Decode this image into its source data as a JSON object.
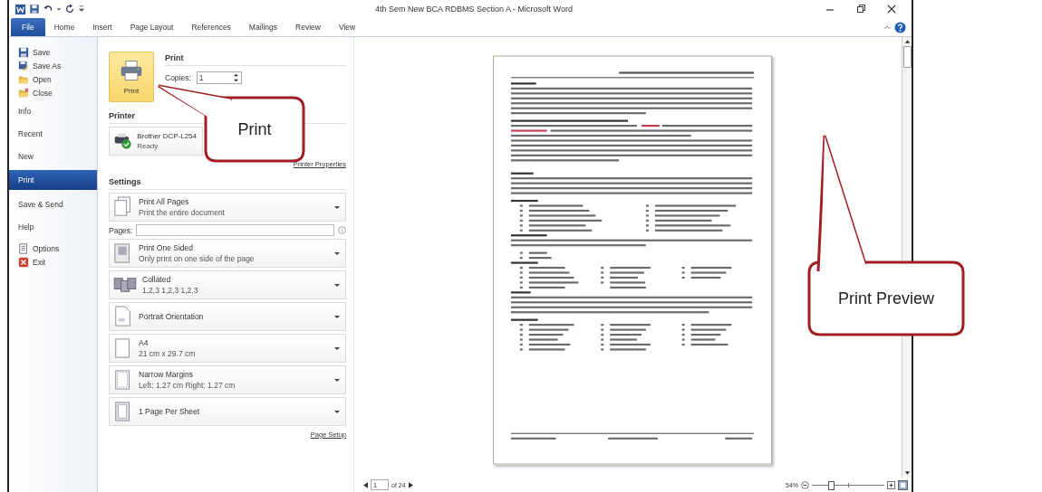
{
  "window": {
    "title": "4th Sem New BCA RDBMS Section A - Microsoft Word"
  },
  "ribbon_tabs": [
    {
      "label": "File",
      "selected": true
    },
    {
      "label": "Home",
      "selected": false
    },
    {
      "label": "Insert",
      "selected": false
    },
    {
      "label": "Page Layout",
      "selected": false
    },
    {
      "label": "References",
      "selected": false
    },
    {
      "label": "Mailings",
      "selected": false
    },
    {
      "label": "Review",
      "selected": false
    },
    {
      "label": "View",
      "selected": false
    }
  ],
  "backstage_nav": [
    {
      "label": "Save",
      "kind": "command",
      "selected": false
    },
    {
      "label": "Save As",
      "kind": "command",
      "selected": false
    },
    {
      "label": "Open",
      "kind": "command",
      "selected": false
    },
    {
      "label": "Close",
      "kind": "command",
      "selected": false
    },
    {
      "label": "Info",
      "kind": "tab",
      "selected": false
    },
    {
      "label": "Recent",
      "kind": "tab",
      "selected": false
    },
    {
      "label": "New",
      "kind": "tab",
      "selected": false
    },
    {
      "label": "Print",
      "kind": "tab",
      "selected": true
    },
    {
      "label": "Save & Send",
      "kind": "tab",
      "selected": false
    },
    {
      "label": "Help",
      "kind": "tab",
      "selected": false
    },
    {
      "label": "Options",
      "kind": "command",
      "selected": false
    },
    {
      "label": "Exit",
      "kind": "command",
      "selected": false
    }
  ],
  "print": {
    "heading": "Print",
    "button": "Print",
    "copies_label": "Copies:",
    "copies": "1"
  },
  "printer": {
    "heading": "Printer",
    "name": "Brother DCP-L254",
    "status": "Ready",
    "properties_link": "Printer Properties"
  },
  "settings": {
    "heading": "Settings",
    "items": [
      {
        "kind": "dropdown",
        "title": "Print All Pages",
        "subtitle": "Print the entire document"
      },
      {
        "kind": "field",
        "label": "Pages:"
      },
      {
        "kind": "dropdown",
        "title": "Print One Sided",
        "subtitle": "Only print on one side of the page"
      },
      {
        "kind": "dropdown",
        "title": "Collated",
        "subtitle": "1,2,3   1,2,3   1,2,3"
      },
      {
        "kind": "dropdown",
        "title": "Portrait Orientation"
      },
      {
        "kind": "dropdown",
        "title": "A4",
        "subtitle": "21 cm x 29.7 cm"
      },
      {
        "kind": "dropdown",
        "title": "Narrow Margins",
        "subtitle": "Left:  1.27 cm   Right:  1.27 cm"
      },
      {
        "kind": "dropdown",
        "title": "1 Page Per Sheet"
      }
    ],
    "page_setup_link": "Page Setup"
  },
  "status_bar": {
    "page": "1",
    "page_total": "of 24",
    "zoom_reading": "54%",
    "zoom": {
      "level": 0.25
    }
  },
  "callouts": [
    {
      "text": "Print"
    },
    {
      "text": "Print Preview"
    }
  ]
}
